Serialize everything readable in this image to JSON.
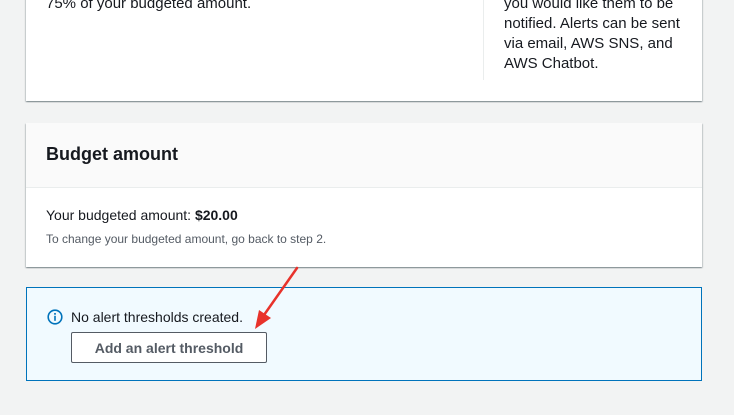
{
  "top_card": {
    "left_text": "75% of your budgeted amount.",
    "right_lines": [
      "you would like them to be",
      "notified. Alerts can be sent",
      "via email, AWS SNS, and",
      "AWS Chatbot."
    ]
  },
  "budget_amount": {
    "title": "Budget amount",
    "label": "Your budgeted amount: ",
    "value": "$20.00",
    "hint": "To change your budgeted amount, go back to step 2."
  },
  "alert": {
    "icon": "info-icon",
    "message": "No alert thresholds created.",
    "button_label": "Add an alert threshold"
  },
  "colors": {
    "page_background": "#f2f3f3",
    "info_blue": "#0073bb",
    "alert_background": "#f1faff",
    "annotation_red": "#e8322b"
  }
}
